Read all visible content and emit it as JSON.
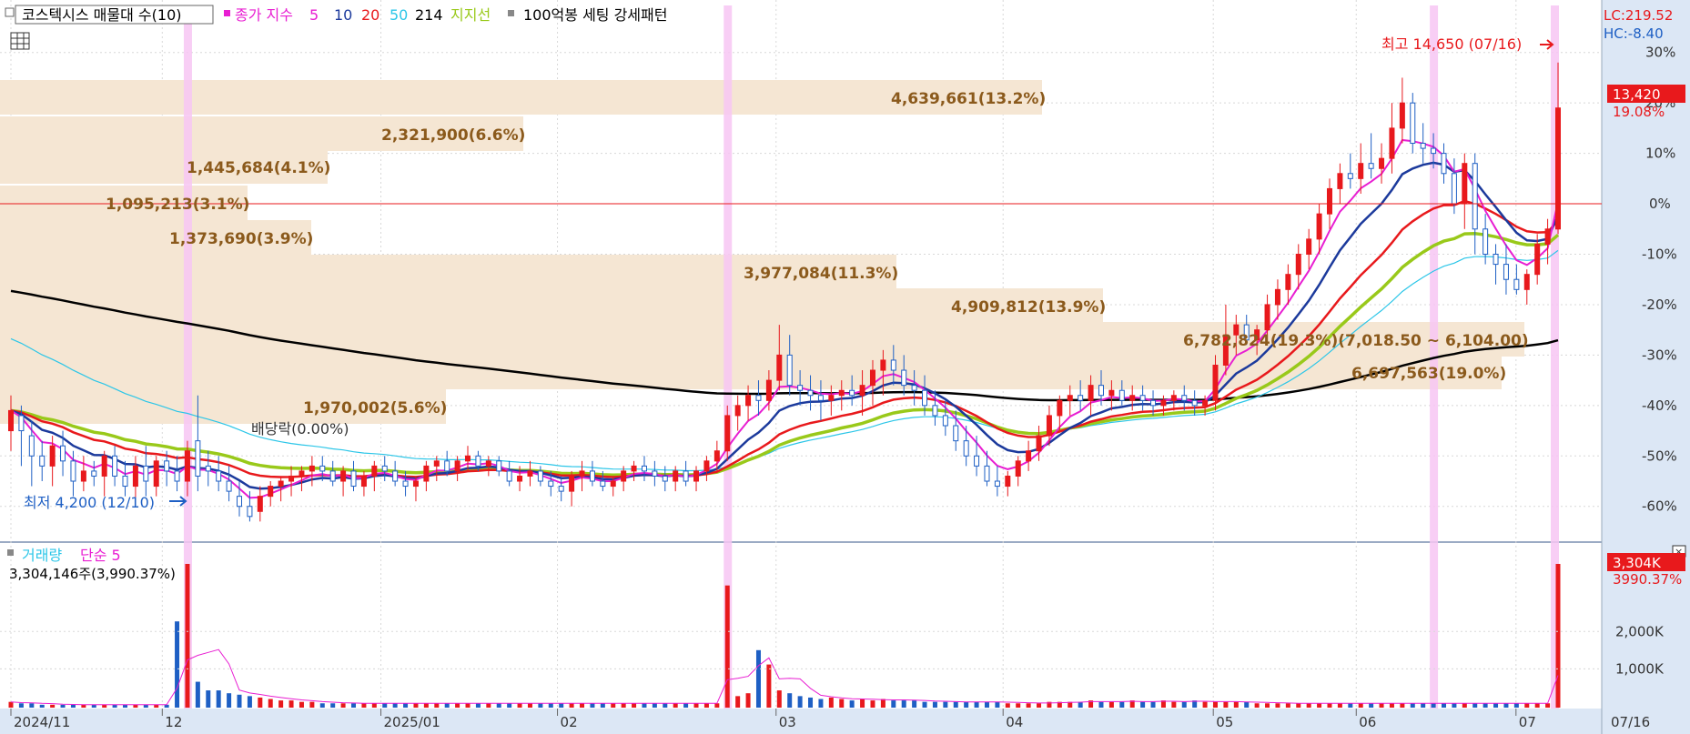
{
  "price_panel": {
    "legend": {
      "title": "코스텍시스 매물대 수(10)",
      "ma_label": "종가 지수",
      "ma_periods": [
        "5",
        "10",
        "20",
        "50",
        "214"
      ],
      "support_label": "지지선",
      "setting_label": "100억봉 세팅 강세패턴"
    },
    "lc_label": "LC:219.52",
    "hc_label": "HC:-8.40",
    "current_price_label": "13,420",
    "current_pct_label": "19.08%",
    "pct_ticks": [
      "30%",
      "20%",
      "10%",
      "0%",
      "-10%",
      "-20%",
      "-30%",
      "-40%",
      "-50%",
      "-60%"
    ],
    "high_marker": "최고 14,650 (07/16)",
    "low_marker": "최저 4,200 (12/10)",
    "dividend_label": "배당락(0.00%)",
    "volume_profile": [
      {
        "label": "4,639,661(13.2%)",
        "level": 0
      },
      {
        "label": "2,321,900(6.6%)",
        "level": 1
      },
      {
        "label": "1,445,684(4.1%)",
        "level": 2
      },
      {
        "label": "1,095,213(3.1%)",
        "level": 3
      },
      {
        "label": "1,373,690(3.9%)",
        "level": 4
      },
      {
        "label": "3,977,084(11.3%)",
        "level": 5
      },
      {
        "label": "4,909,812(13.9%)",
        "level": 6
      },
      {
        "label": "6,782,824(19.3%)(7,018.50 ~ 6,104.00)",
        "level": 7
      },
      {
        "label": "6,697,563(19.0%)",
        "level": 8
      },
      {
        "label": "1,970,002(5.6%)",
        "level": 9
      }
    ]
  },
  "volume_panel": {
    "legend_name": "거래량",
    "legend_ma": "단순 5",
    "value_label": "3,304,146주(3,990.37%)",
    "current_volume_label": "3,304K",
    "current_volume_pct": "3990.37%",
    "ticks": [
      "2,000K",
      "1,000K"
    ]
  },
  "x_axis": {
    "labels": [
      "2024/11",
      "12",
      "2025/01",
      "02",
      "03",
      "04",
      "05",
      "06",
      "07"
    ],
    "current_date": "07/16"
  },
  "colors": {
    "up": "#e8191c",
    "down": "#1e5fc4",
    "ma5": "#e81ed2",
    "ma10": "#1c3a9c",
    "ma20": "#e8191c",
    "ma50": "#2cc6e8",
    "ma214": "#000000",
    "support": "#99c91a",
    "profile_bar": "#f5e6d3",
    "marker": "#f7c6f3"
  },
  "chart_data": {
    "type": "candlestick",
    "ylim_pct": [
      -66,
      35
    ],
    "ohlc": [
      [
        -45,
        -38,
        -49,
        -41
      ],
      [
        -42,
        -40,
        -52,
        -45
      ],
      [
        -46,
        -43,
        -56,
        -50
      ],
      [
        -50,
        -47,
        -55,
        -52
      ],
      [
        -52,
        -46,
        -56,
        -48
      ],
      [
        -48,
        -45,
        -54,
        -51
      ],
      [
        -51,
        -49,
        -58,
        -55
      ],
      [
        -55,
        -50,
        -57,
        -53
      ],
      [
        -53,
        -51,
        -56,
        -54
      ],
      [
        -54,
        -49,
        -58,
        -50
      ],
      [
        -50,
        -48,
        -56,
        -54
      ],
      [
        -54,
        -51,
        -58,
        -56
      ],
      [
        -56,
        -50,
        -60,
        -52
      ],
      [
        -52,
        -48,
        -58,
        -55
      ],
      [
        -56,
        -50,
        -58,
        -51
      ],
      [
        -51,
        -49,
        -56,
        -53
      ],
      [
        -53,
        -50,
        -57,
        -55
      ],
      [
        -55,
        -47,
        -58,
        -49
      ],
      [
        -47,
        -38,
        -57,
        -54
      ],
      [
        -52,
        -49,
        -56,
        -53
      ],
      [
        -53,
        -50,
        -57,
        -55
      ],
      [
        -55,
        -52,
        -59,
        -57
      ],
      [
        -58,
        -55,
        -62,
        -60
      ],
      [
        -60,
        -57,
        -63,
        -62
      ],
      [
        -61,
        -56,
        -63,
        -58
      ],
      [
        -58,
        -55,
        -60,
        -56
      ],
      [
        -56,
        -54,
        -59,
        -55
      ],
      [
        -55,
        -52,
        -58,
        -54
      ],
      [
        -54,
        -52,
        -57,
        -53
      ],
      [
        -53,
        -50,
        -56,
        -52
      ],
      [
        -52,
        -50,
        -55,
        -53
      ],
      [
        -53,
        -51,
        -56,
        -55
      ],
      [
        -55,
        -52,
        -58,
        -53
      ],
      [
        -53,
        -51,
        -57,
        -56
      ],
      [
        -56,
        -53,
        -58,
        -54
      ],
      [
        -54,
        -51,
        -57,
        -52
      ],
      [
        -52,
        -50,
        -55,
        -53
      ],
      [
        -53,
        -51,
        -56,
        -55
      ],
      [
        -55,
        -53,
        -58,
        -56
      ],
      [
        -56,
        -54,
        -59,
        -55
      ],
      [
        -55,
        -51,
        -57,
        -52
      ],
      [
        -52,
        -50,
        -55,
        -51
      ],
      [
        -51,
        -49,
        -54,
        -53
      ],
      [
        -53,
        -50,
        -55,
        -51
      ],
      [
        -51,
        -48,
        -53,
        -50
      ],
      [
        -50,
        -49,
        -53,
        -52
      ],
      [
        -52,
        -50,
        -54,
        -51
      ],
      [
        -51,
        -50,
        -54,
        -53
      ],
      [
        -53,
        -51,
        -56,
        -55
      ],
      [
        -55,
        -52,
        -57,
        -54
      ],
      [
        -54,
        -51,
        -56,
        -53
      ],
      [
        -53,
        -52,
        -56,
        -55
      ],
      [
        -55,
        -53,
        -58,
        -56
      ],
      [
        -56,
        -54,
        -59,
        -57
      ],
      [
        -57,
        -53,
        -60,
        -54
      ],
      [
        -54,
        -51,
        -57,
        -53
      ],
      [
        -53,
        -51,
        -56,
        -55
      ],
      [
        -55,
        -53,
        -57,
        -56
      ],
      [
        -56,
        -54,
        -58,
        -55
      ],
      [
        -55,
        -52,
        -57,
        -53
      ],
      [
        -53,
        -51,
        -55,
        -52
      ],
      [
        -52,
        -50,
        -55,
        -53
      ],
      [
        -53,
        -51,
        -56,
        -54
      ],
      [
        -54,
        -52,
        -57,
        -55
      ],
      [
        -55,
        -52,
        -57,
        -53
      ],
      [
        -53,
        -51,
        -56,
        -55
      ],
      [
        -55,
        -52,
        -57,
        -53
      ],
      [
        -53,
        -50,
        -55,
        -51
      ],
      [
        -51,
        -47,
        -53,
        -49
      ],
      [
        -49,
        -40,
        -51,
        -42
      ],
      [
        -42,
        -38,
        -45,
        -40
      ],
      [
        -40,
        -36,
        -43,
        -38
      ],
      [
        -38,
        -35,
        -42,
        -39
      ],
      [
        -39,
        -33,
        -41,
        -35
      ],
      [
        -35,
        -24,
        -37,
        -30
      ],
      [
        -30,
        -26,
        -38,
        -36
      ],
      [
        -36,
        -33,
        -40,
        -37
      ],
      [
        -37,
        -34,
        -41,
        -38
      ],
      [
        -38,
        -35,
        -43,
        -39
      ],
      [
        -39,
        -36,
        -42,
        -38
      ],
      [
        -38,
        -35,
        -41,
        -37
      ],
      [
        -37,
        -34,
        -40,
        -38
      ],
      [
        -38,
        -33,
        -42,
        -36
      ],
      [
        -36,
        -31,
        -40,
        -33
      ],
      [
        -33,
        -29,
        -38,
        -31
      ],
      [
        -31,
        -28,
        -36,
        -33
      ],
      [
        -33,
        -30,
        -38,
        -36
      ],
      [
        -36,
        -33,
        -40,
        -37
      ],
      [
        -37,
        -34,
        -42,
        -40
      ],
      [
        -40,
        -37,
        -44,
        -42
      ],
      [
        -42,
        -39,
        -46,
        -44
      ],
      [
        -44,
        -41,
        -49,
        -47
      ],
      [
        -47,
        -44,
        -52,
        -50
      ],
      [
        -50,
        -46,
        -54,
        -52
      ],
      [
        -52,
        -49,
        -56,
        -55
      ],
      [
        -55,
        -52,
        -58,
        -56
      ],
      [
        -56,
        -53,
        -58,
        -54
      ],
      [
        -54,
        -50,
        -56,
        -51
      ],
      [
        -51,
        -47,
        -53,
        -49
      ],
      [
        -49,
        -44,
        -51,
        -46
      ],
      [
        -46,
        -40,
        -48,
        -42
      ],
      [
        -42,
        -38,
        -45,
        -39
      ],
      [
        -39,
        -36,
        -42,
        -38
      ],
      [
        -38,
        -35,
        -41,
        -39
      ],
      [
        -39,
        -34,
        -42,
        -36
      ],
      [
        -36,
        -33,
        -40,
        -38
      ],
      [
        -38,
        -35,
        -41,
        -37
      ],
      [
        -37,
        -35,
        -40,
        -39
      ],
      [
        -39,
        -36,
        -41,
        -38
      ],
      [
        -38,
        -36,
        -41,
        -39
      ],
      [
        -39,
        -37,
        -42,
        -40
      ],
      [
        -40,
        -38,
        -42,
        -39
      ],
      [
        -39,
        -37,
        -41,
        -38
      ],
      [
        -38,
        -36,
        -41,
        -39
      ],
      [
        -39,
        -37,
        -42,
        -40
      ],
      [
        -40,
        -38,
        -42,
        -39
      ],
      [
        -39,
        -30,
        -41,
        -32
      ],
      [
        -32,
        -20,
        -34,
        -26
      ],
      [
        -26,
        -22,
        -30,
        -24
      ],
      [
        -24,
        -22,
        -28,
        -27
      ],
      [
        -27,
        -24,
        -30,
        -25
      ],
      [
        -25,
        -18,
        -28,
        -20
      ],
      [
        -20,
        -15,
        -23,
        -17
      ],
      [
        -17,
        -12,
        -20,
        -14
      ],
      [
        -14,
        -8,
        -17,
        -10
      ],
      [
        -10,
        -5,
        -13,
        -7
      ],
      [
        -7,
        0,
        -10,
        -2
      ],
      [
        -2,
        5,
        -5,
        3
      ],
      [
        3,
        8,
        0,
        6
      ],
      [
        6,
        10,
        3,
        5
      ],
      [
        5,
        12,
        2,
        8
      ],
      [
        8,
        14,
        5,
        7
      ],
      [
        7,
        12,
        4,
        9
      ],
      [
        9,
        20,
        6,
        15
      ],
      [
        15,
        25,
        12,
        20
      ],
      [
        20,
        22,
        10,
        12
      ],
      [
        12,
        16,
        8,
        11
      ],
      [
        11,
        14,
        7,
        10
      ],
      [
        10,
        12,
        4,
        6
      ],
      [
        6,
        9,
        -2,
        0
      ],
      [
        0,
        10,
        -5,
        8
      ],
      [
        8,
        10,
        -10,
        -5
      ],
      [
        -5,
        -2,
        -12,
        -10
      ],
      [
        -10,
        -8,
        -16,
        -12
      ],
      [
        -12,
        -8,
        -18,
        -15
      ],
      [
        -15,
        -12,
        -18,
        -17
      ],
      [
        -17,
        -13,
        -20,
        -14
      ],
      [
        -14,
        -6,
        -16,
        -8
      ],
      [
        -8,
        -3,
        -12,
        -5
      ],
      [
        -5,
        28,
        -6,
        19
      ]
    ],
    "volume": [
      0.04,
      0.03,
      0.03,
      0.02,
      0.02,
      0.02,
      0.02,
      0.02,
      0.02,
      0.02,
      0.02,
      0.02,
      0.02,
      0.02,
      0.02,
      0.02,
      0.6,
      1.0,
      0.18,
      0.12,
      0.12,
      0.1,
      0.09,
      0.08,
      0.07,
      0.06,
      0.05,
      0.05,
      0.04,
      0.04,
      0.03,
      0.03,
      0.03,
      0.03,
      0.03,
      0.03,
      0.03,
      0.03,
      0.03,
      0.03,
      0.03,
      0.03,
      0.03,
      0.03,
      0.03,
      0.03,
      0.03,
      0.03,
      0.03,
      0.03,
      0.03,
      0.03,
      0.03,
      0.03,
      0.03,
      0.03,
      0.03,
      0.03,
      0.03,
      0.03,
      0.03,
      0.03,
      0.03,
      0.03,
      0.03,
      0.03,
      0.03,
      0.03,
      0.03,
      0.85,
      0.08,
      0.1,
      0.4,
      0.3,
      0.12,
      0.1,
      0.08,
      0.07,
      0.06,
      0.07,
      0.06,
      0.05,
      0.06,
      0.05,
      0.06,
      0.05,
      0.05,
      0.05,
      0.04,
      0.04,
      0.04,
      0.04,
      0.04,
      0.04,
      0.04,
      0.04,
      0.03,
      0.03,
      0.03,
      0.03,
      0.04,
      0.04,
      0.04,
      0.04,
      0.05,
      0.04,
      0.04,
      0.04,
      0.05,
      0.04,
      0.04,
      0.05,
      0.04,
      0.04,
      0.05,
      0.04,
      0.04,
      0.04,
      0.04,
      0.04,
      0.03,
      0.03,
      0.03,
      0.03,
      0.03,
      0.03,
      0.03,
      0.03,
      0.03,
      0.03,
      0.03,
      0.03,
      0.03,
      0.03,
      0.03,
      0.03,
      0.03,
      0.03,
      0.03,
      0.03,
      0.03,
      0.03,
      0.03,
      0.03,
      0.03,
      0.03,
      0.03,
      0.03,
      0.03,
      1.0
    ]
  }
}
